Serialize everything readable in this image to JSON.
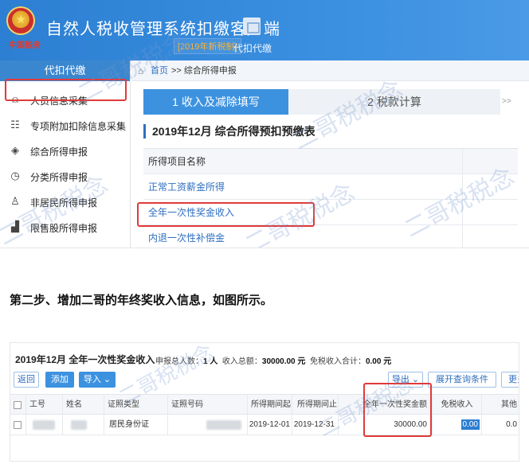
{
  "app": {
    "emblem_text": "中国税务",
    "title": "自然人税收管理系统扣缴客户端",
    "version_badge": "[2019年新税制]",
    "agent_label": "代扣代缴"
  },
  "sidebar": {
    "header": "代扣代缴",
    "items": [
      {
        "label": "人员信息采集",
        "icon": "person-card-icon"
      },
      {
        "label": "专项附加扣除信息采集",
        "icon": "list-icon"
      },
      {
        "label": "综合所得申报",
        "icon": "layers-icon"
      },
      {
        "label": "分类所得申报",
        "icon": "clock-icon"
      },
      {
        "label": "非居民所得申报",
        "icon": "person-icon"
      },
      {
        "label": "限售股所得申报",
        "icon": "bar-chart-icon"
      }
    ]
  },
  "breadcrumb": {
    "home": "首页",
    "rest": ">> 综合所得申报"
  },
  "steps": {
    "step1": "1 收入及减除填写",
    "step2": "2 税款计算",
    "more": ">>"
  },
  "form_title": "2019年12月  综合所得预扣预缴表",
  "item_table": {
    "header": "所得项目名称",
    "rows": [
      "正常工资薪金所得",
      "全年一次性奖金收入",
      "内退一次性补偿金"
    ]
  },
  "caption": "第二步、增加二哥的年终奖收入信息，如图所示。",
  "bonus_panel": {
    "title": "2019年12月 全年一次性奖金收入",
    "summary_people_label": "申报总人数：",
    "summary_people": "1 人",
    "summary_income_label": "收入总额：",
    "summary_income": "30000.00 元",
    "summary_exempt_label": "免税收入合计：",
    "summary_exempt": "0.00 元",
    "buttons": {
      "back": "返回",
      "add": "添加",
      "import": "导入 ⌄",
      "export": "导出 ⌄",
      "expand": "展开查询条件",
      "more": "更多"
    },
    "columns": [
      "工号",
      "姓名",
      "证照类型",
      "证照号码",
      "所得期间起",
      "所得期间止",
      "全年一次性奖金额",
      "免税收入",
      "其他"
    ],
    "row": {
      "id_type": "居民身份证",
      "period_start": "2019-12-01",
      "period_end": "2019-12-31",
      "bonus_amount": "30000.00",
      "exempt_income": "0.00",
      "other": "0.0"
    }
  },
  "watermark": "二哥税税念"
}
